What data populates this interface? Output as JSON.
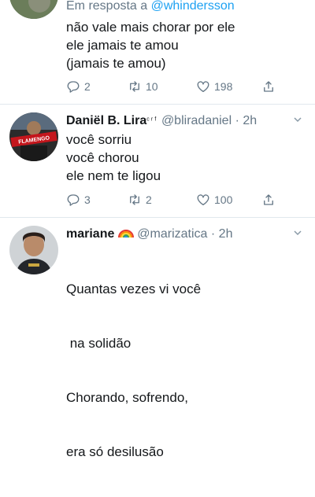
{
  "tweets": [
    {
      "reply_prefix": "Em resposta a ",
      "reply_to": "@whindersson",
      "lines": [
        "não vale mais chorar por ele",
        "ele jamais te amou",
        "(jamais te amou)"
      ],
      "actions": {
        "replies": "2",
        "retweets": "10",
        "likes": "198"
      }
    },
    {
      "name": "Daniël B. Lira",
      "badge": "ᶜʳᶠ",
      "handle": "@bliradaniel",
      "time": "· 2h",
      "avatar_text": "FLAMENGO",
      "lines": [
        "você sorriu",
        "você chorou",
        "ele nem te ligou"
      ],
      "actions": {
        "replies": "3",
        "retweets": "2",
        "likes": "100"
      }
    },
    {
      "name": "mariane",
      "handle": "@marizatica",
      "time": "· 2h",
      "lines": [
        "Quantas vezes vi você",
        " na solidão",
        "Chorando, sofrendo,",
        "era só desilusão"
      ]
    }
  ],
  "colors": {
    "text": "#14171a",
    "secondary": "#657786",
    "accent": "#1da1f2",
    "divider": "#e1e8ed"
  },
  "icons": [
    "reply-icon",
    "retweet-icon",
    "like-icon",
    "share-icon",
    "chevron-down-icon",
    "rainbow-emoji"
  ]
}
